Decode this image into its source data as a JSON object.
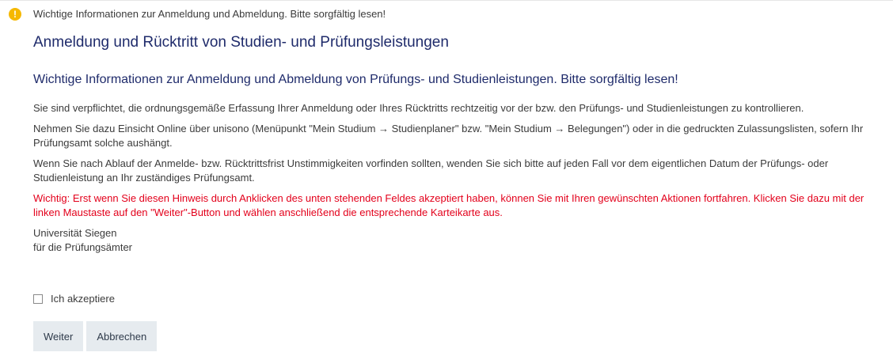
{
  "notice": {
    "icon": "warning-icon",
    "text": "Wichtige Informationen zur Anmeldung und Abmeldung. Bitte sorgfältig lesen!"
  },
  "page": {
    "title": "Anmeldung und Rücktritt von Studien- und Prüfungsleistungen",
    "subtitle": "Wichtige Informationen zur Anmeldung und Abmeldung von Prüfungs- und Studienleistungen. Bitte sorgfältig lesen!"
  },
  "content": {
    "paragraph1": "Sie sind verpflichtet, die ordnungsgemäße Erfassung Ihrer Anmeldung oder Ihres Rücktritts rechtzeitig vor der bzw. den Prüfungs- und Studienleistungen zu kontrollieren.",
    "paragraph2": "Nehmen Sie dazu Einsicht Online über unisono (Menüpunkt \"Mein Studium → Studienplaner\" bzw. \"Mein Studium → Belegungen\") oder in die gedruckten Zulassungslisten, sofern Ihr Prüfungsamt solche aushängt.",
    "paragraph3": "Wenn Sie nach Ablauf der Anmelde- bzw. Rücktrittsfrist Unstimmigkeiten vorfinden sollten, wenden Sie sich bitte auf jeden Fall vor dem eigentlichen Datum der Prüfungs- oder Studienleistung an Ihr zuständiges Prüfungsamt.",
    "warning": "Wichtig: Erst wenn Sie diesen Hinweis durch Anklicken des unten stehenden Feldes akzeptiert haben, können Sie mit Ihren gewünschten Aktionen fortfahren. Klicken Sie dazu mit der linken Maustaste auf den \"Weiter\"-Button und wählen anschließend die entsprechende Karteikarte aus.",
    "signature_line1": "Universität Siegen",
    "signature_line2": "für die Prüfungsämter"
  },
  "form": {
    "accept_label": "Ich akzeptiere",
    "accept_checked": false,
    "continue_label": "Weiter",
    "cancel_label": "Abbrechen"
  },
  "colors": {
    "heading": "#1f2b6b",
    "warning_text": "#e3001b",
    "notice_icon": "#f5b800",
    "button_bg": "#e6ebef"
  }
}
